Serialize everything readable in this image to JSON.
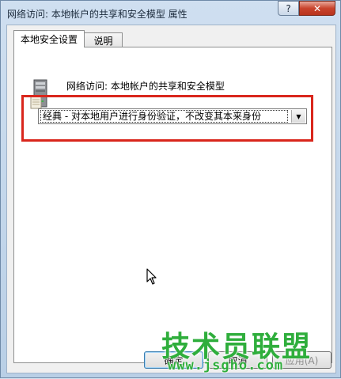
{
  "window": {
    "title": "网络访问: 本地帐户的共享和安全模型 属性",
    "help_label": "?",
    "close_label": "✕"
  },
  "tabs": [
    {
      "label": "本地安全设置",
      "active": true
    },
    {
      "label": "说明",
      "active": false
    }
  ],
  "policy": {
    "title": "网络访问: 本地帐户的共享和安全模型",
    "icon": "server-icon"
  },
  "dropdown": {
    "selected": "经典 - 对本地用户进行身份验证，不改变其本来身份",
    "arrow": "▼"
  },
  "buttons": {
    "ok": "确定",
    "cancel": "取消",
    "apply": "应用(A)"
  },
  "watermark": {
    "main": "技术员联盟",
    "url": "www.jsgho.com"
  },
  "colors": {
    "highlight_box": "#d9261c",
    "watermark": "#2fae3c"
  }
}
